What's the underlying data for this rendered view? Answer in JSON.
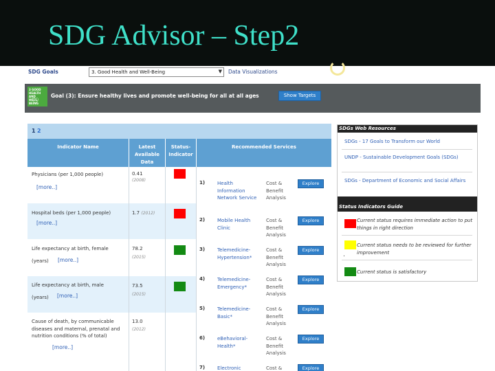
{
  "slide": {
    "title": "SDG Advisor – Step2"
  },
  "toolbar": {
    "sdg_goals_label": "SDG Goals",
    "goal_select_value": "3. Good Health and Well-Being",
    "data_viz_link": "Data Visualizations"
  },
  "goal_banner": {
    "icon_text": "3 GOOD HEALTH AND WELL-BEING",
    "title": "Goal (3): Ensure healthy lives and promote well-being for all at all ages",
    "show_targets_label": "Show Targets"
  },
  "table": {
    "pages": [
      "1",
      "2"
    ],
    "headers": {
      "indicator": "Indicator Name",
      "latest": "Latest Available Data",
      "status": "Status-Indicator",
      "services": "Recommended Services"
    },
    "rows": [
      {
        "name": "Physicians (per 1,000 people)",
        "more": "[more..]",
        "value": "0.41",
        "year": "(2008)",
        "status_color": "#ff0000"
      },
      {
        "name": "Hospital beds (per 1,000 people)",
        "more": "[more..]",
        "value": "1.7",
        "year": "(2012)",
        "status_color": "#ff0000"
      },
      {
        "name": "Life expectancy at birth, female",
        "name2": "(years)",
        "more": "[more..]",
        "value": "78.2",
        "year": "(2015)",
        "status_color": "#138a13"
      },
      {
        "name": "Life expectancy at birth, male",
        "name2": "(years)",
        "more": "[more..]",
        "value": "73.5",
        "year": "(2015)",
        "status_color": "#138a13"
      },
      {
        "name": "Cause of death, by communicable diseases and maternal, prenatal and nutrition conditions (% of total)",
        "more": "[more..]",
        "value": "13.0",
        "year": "(2012)",
        "status_color": ""
      }
    ],
    "services": [
      {
        "num": "1)",
        "name": "Health Information Network Service",
        "cba": "Cost & Benefit Analysis",
        "explore": "Explore"
      },
      {
        "num": "2)",
        "name": "Mobile Health Clinic",
        "cba": "Cost & Benefit Analysis",
        "explore": "Explore"
      },
      {
        "num": "3)",
        "name": "Telemedicine-Hypertension*",
        "cba": "Cost & Benefit Analysis",
        "explore": "Explore"
      },
      {
        "num": "4)",
        "name": "Telemedicine-Emergency*",
        "cba": "Cost & Benefit Analysis",
        "explore": "Explore"
      },
      {
        "num": "5)",
        "name": "Telemedicine-Basic*",
        "cba": "Cost & Benefit Analysis",
        "explore": "Explore"
      },
      {
        "num": "6)",
        "name": "eBehavioral-Health*",
        "cba": "Cost & Benefit Analysis",
        "explore": "Explore"
      },
      {
        "num": "7)",
        "name": "Electronic",
        "cba": "Cost &",
        "explore": "Explore"
      }
    ]
  },
  "resources": {
    "heading": "SDGs Web Resources",
    "links": [
      "SDGs - 17 Goals to Transform our World",
      "UNDP - Sustainable Development Goals (SDGs)",
      "SDGs - Department of Economic and Social Affairs"
    ],
    "guide_heading": "Status Indicators Guide",
    "guide": [
      {
        "color": "#ff0000",
        "text": "Current status requires immediate action to put things in right direction"
      },
      {
        "color": "#ffff00",
        "text": "Current status needs to be reviewed for further improvement"
      },
      {
        "color": "#138a13",
        "text": "Current status is satisfactory"
      }
    ],
    "stray_mark": "."
  }
}
